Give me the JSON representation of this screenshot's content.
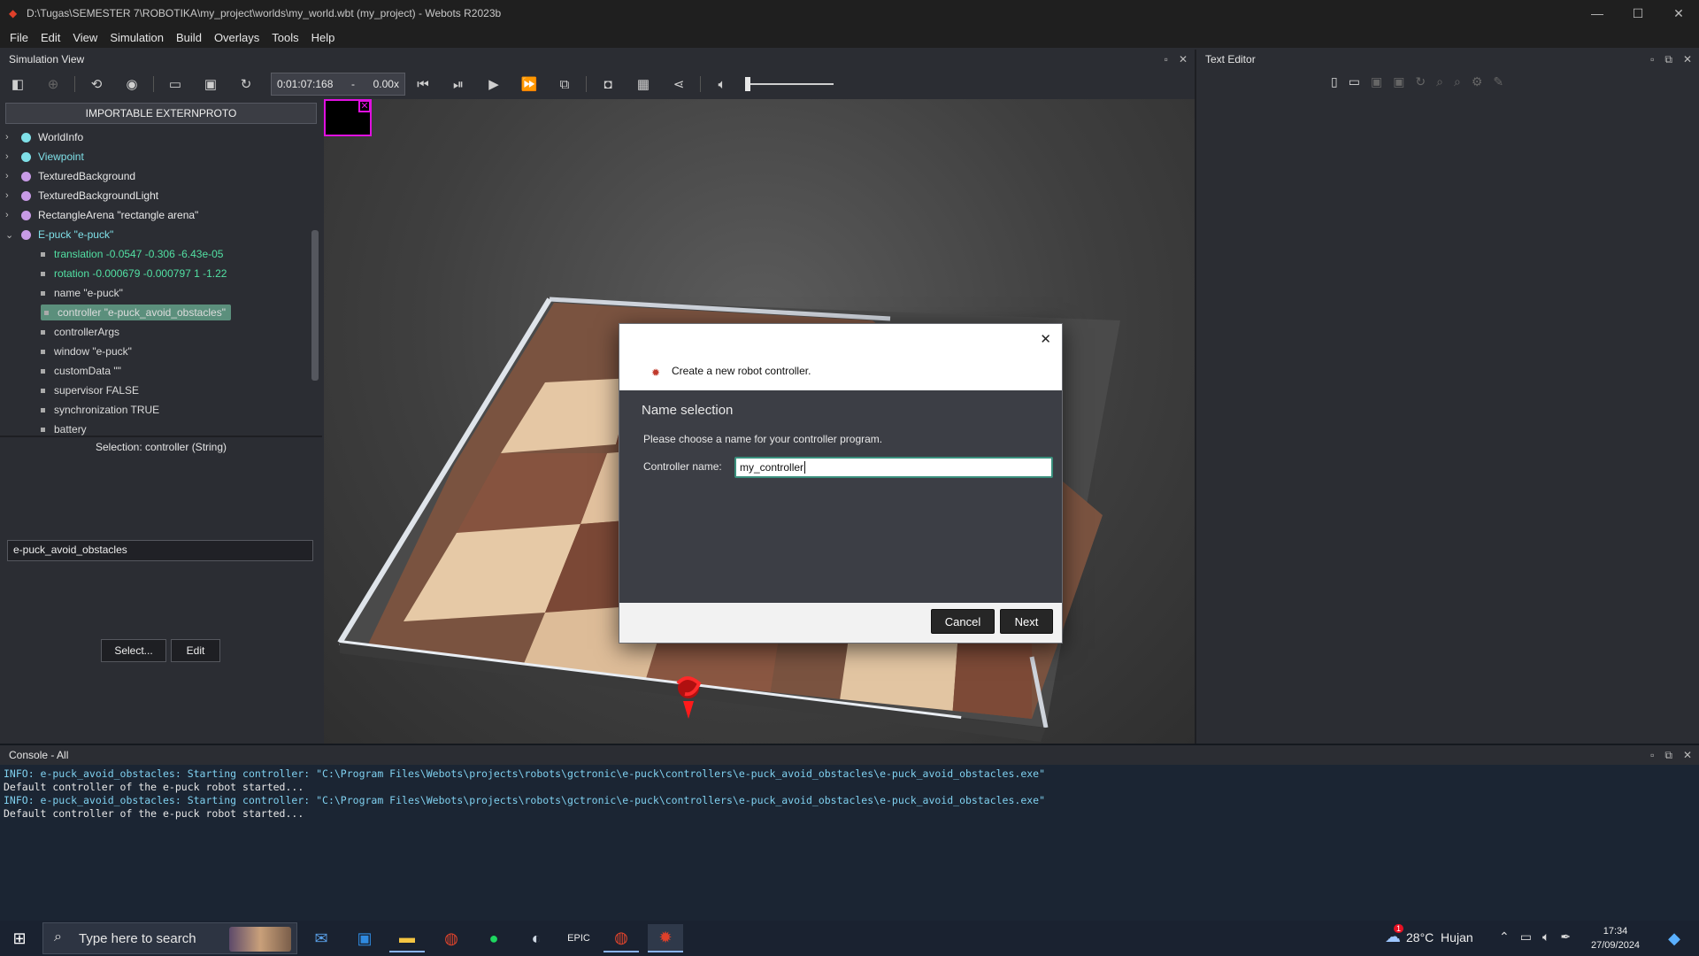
{
  "window": {
    "title": "D:\\Tugas\\SEMESTER 7\\ROBOTIKA\\my_project\\worlds\\my_world.wbt (my_project) - Webots R2023b"
  },
  "menu": [
    "File",
    "Edit",
    "View",
    "Simulation",
    "Build",
    "Overlays",
    "Tools",
    "Help"
  ],
  "simulation_view": {
    "title": "Simulation View"
  },
  "text_editor": {
    "title": "Text Editor"
  },
  "toolbar": {
    "time": "0:01:07:168",
    "speed": "0.00x",
    "dash": "-"
  },
  "scene_tree": {
    "importable_button": "IMPORTABLE EXTERNPROTO",
    "nodes": [
      {
        "label": "WorldInfo",
        "color": "#7fe0e8",
        "arrow": "›"
      },
      {
        "label": "Viewpoint",
        "color": "#7fe0e8",
        "arrow": "›",
        "highlight": true
      },
      {
        "label": "TexturedBackground",
        "color": "#c89be6",
        "arrow": "›"
      },
      {
        "label": "TexturedBackgroundLight",
        "color": "#c89be6",
        "arrow": "›"
      },
      {
        "label": "RectangleArena \"rectangle arena\"",
        "color": "#c89be6",
        "arrow": "›"
      },
      {
        "label": "E-puck \"e-puck\"",
        "color": "#c89be6",
        "arrow": "⌄",
        "highlight": true
      }
    ],
    "fields": [
      {
        "label": "translation -0.0547 -0.306 -6.43e-05",
        "green": true
      },
      {
        "label": "rotation -0.000679 -0.000797 1 -1.22",
        "green": true
      },
      {
        "label": "name \"e-puck\""
      },
      {
        "label": "controller \"e-puck_avoid_obstacles\"",
        "selected": true
      },
      {
        "label": "controllerArgs"
      },
      {
        "label": "window \"e-puck\""
      },
      {
        "label": "customData \"\""
      },
      {
        "label": "supervisor FALSE"
      },
      {
        "label": "synchronization TRUE"
      },
      {
        "label": "battery"
      }
    ]
  },
  "selection_panel": {
    "title": "Selection: controller (String)",
    "value": "e-puck_avoid_obstacles",
    "select_button": "Select...",
    "edit_button": "Edit"
  },
  "dialog": {
    "header": "Create a new robot controller.",
    "section_title": "Name selection",
    "prompt": "Please choose a name for your controller program.",
    "field_label": "Controller name:",
    "field_value": "my_controller",
    "cancel_button": "Cancel",
    "next_button": "Next"
  },
  "console": {
    "title": "Console - All",
    "lines": [
      {
        "text": "INFO: e-puck_avoid_obstacles: Starting controller: \"C:\\Program Files\\Webots\\projects\\robots\\gctronic\\e-puck\\controllers\\e-puck_avoid_obstacles\\e-puck_avoid_obstacles.exe\"",
        "kind": "info"
      },
      {
        "text": "Default controller of the e-puck robot started...",
        "kind": "plain"
      },
      {
        "text": "INFO: e-puck_avoid_obstacles: Starting controller: \"C:\\Program Files\\Webots\\projects\\robots\\gctronic\\e-puck\\controllers\\e-puck_avoid_obstacles\\e-puck_avoid_obstacles.exe\"",
        "kind": "info"
      },
      {
        "text": "Default controller of the e-puck robot started...",
        "kind": "plain"
      }
    ]
  },
  "taskbar": {
    "search_placeholder": "Type here to search",
    "weather": "28°C  Hujan",
    "weather_badge": "1",
    "time": "17:34",
    "date": "27/09/2024"
  }
}
